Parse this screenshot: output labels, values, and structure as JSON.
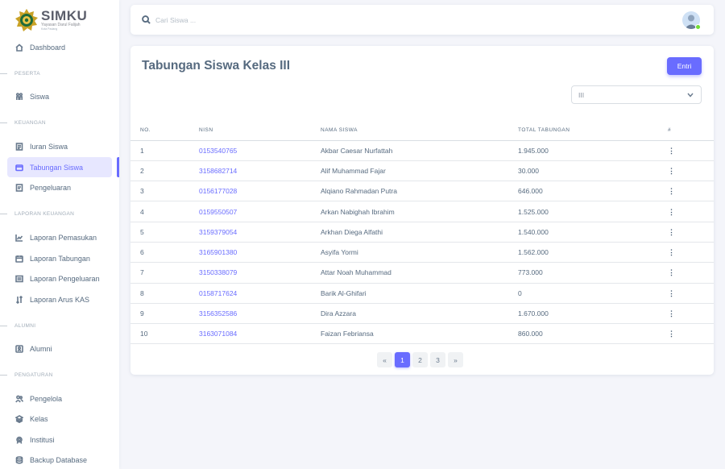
{
  "brand": {
    "name": "SIMKU",
    "subtitle": "Yayasan Darul Falijah",
    "tagline": "Kota Padang"
  },
  "sidebar": {
    "dashboard": "Dashboard",
    "section_peserta": "PESERTA",
    "siswa": "Siswa",
    "section_keuangan": "KEUANGAN",
    "iuran_siswa": "Iuran Siswa",
    "tabungan_siswa": "Tabungan Siswa",
    "pengeluaran": "Pengeluaran",
    "section_laporan": "LAPORAN KEUANGAN",
    "laporan_pemasukan": "Laporan Pemasukan",
    "laporan_tabungan": "Laporan Tabungan",
    "laporan_pengeluaran": "Laporan Pengeluaran",
    "laporan_arus_kas": "Laporan Arus KAS",
    "section_alumni": "ALUMNI",
    "alumni": "Alumni",
    "section_pengaturan": "PENGATURAN",
    "pengelola": "Pengelola",
    "kelas": "Kelas",
    "institusi": "Institusi",
    "backup_database": "Backup Database"
  },
  "search": {
    "placeholder": "Cari Siswa ..."
  },
  "page": {
    "title": "Tabungan Siswa Kelas III",
    "entri_label": "Entri",
    "class_select_value": "III"
  },
  "table": {
    "headers": {
      "no": "NO.",
      "nisn": "NISN",
      "nama": "NAMA SISWA",
      "total": "TOTAL TABUNGAN",
      "action": "#"
    },
    "rows": [
      {
        "no": "1",
        "nisn": "0153540765",
        "nama": "Akbar Caesar Nurfattah",
        "total": "1.945.000"
      },
      {
        "no": "2",
        "nisn": "3158682714",
        "nama": "Alif Muhammad Fajar",
        "total": "30.000"
      },
      {
        "no": "3",
        "nisn": "0156177028",
        "nama": "Alqiano Rahmadan Putra",
        "total": "646.000"
      },
      {
        "no": "4",
        "nisn": "0159550507",
        "nama": "Arkan Nabighah Ibrahim",
        "total": "1.525.000"
      },
      {
        "no": "5",
        "nisn": "3159379054",
        "nama": "Arkhan Diega Alfathi",
        "total": "1.540.000"
      },
      {
        "no": "6",
        "nisn": "3165901380",
        "nama": "Asyifa Yormi",
        "total": "1.562.000"
      },
      {
        "no": "7",
        "nisn": "3150338079",
        "nama": "Attar Noah Muhammad",
        "total": "773.000"
      },
      {
        "no": "8",
        "nisn": "0158717624",
        "nama": "Barik Al-Ghifari",
        "total": "0"
      },
      {
        "no": "9",
        "nisn": "3156352586",
        "nama": "Dira Azzara",
        "total": "1.670.000"
      },
      {
        "no": "10",
        "nisn": "3163071084",
        "nama": "Faizan Febriansa",
        "total": "860.000"
      }
    ],
    "row_menu": "⋮"
  },
  "pagination": {
    "first": "«",
    "pages": [
      "1",
      "2",
      "3"
    ],
    "last": "»",
    "current": "1"
  },
  "colors": {
    "accent": "#696cff",
    "online": "#71dd37"
  }
}
